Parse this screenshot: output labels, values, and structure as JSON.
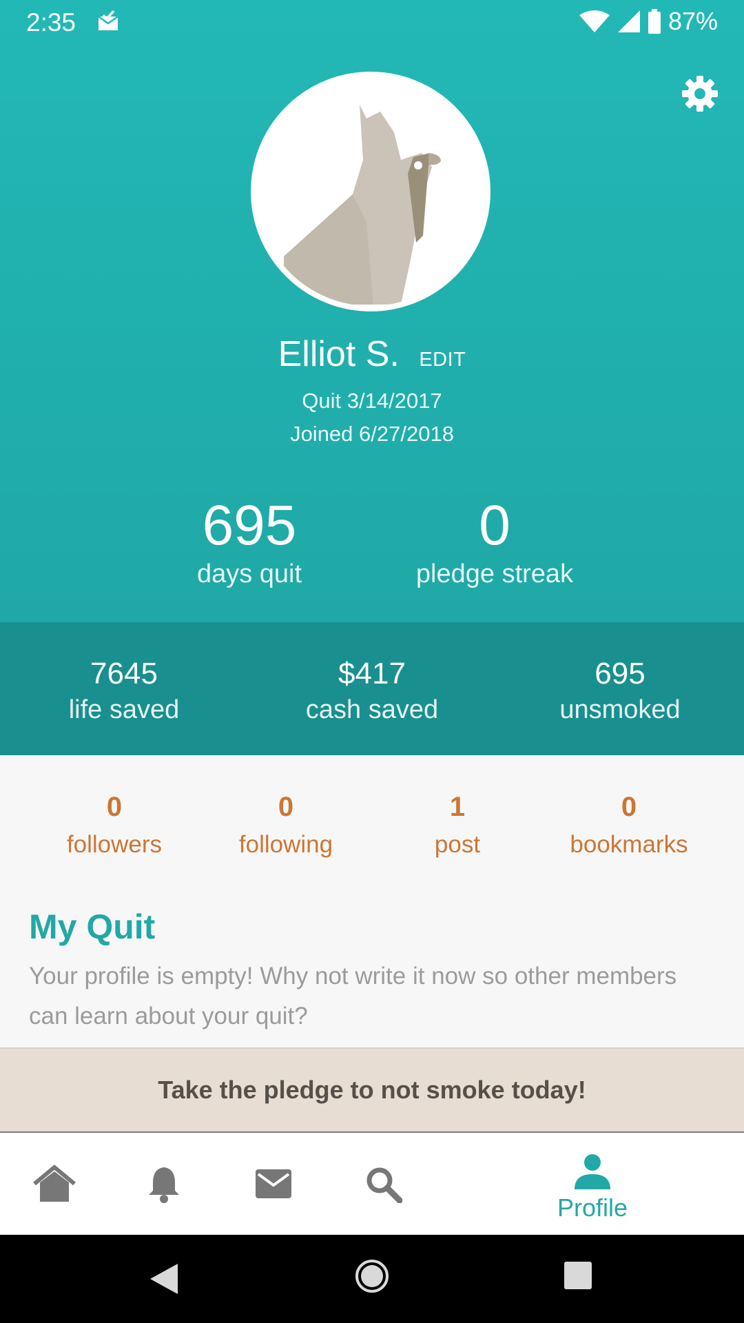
{
  "status_bar": {
    "time": "2:35",
    "battery": "87%",
    "icons": [
      "mail-check-icon",
      "wifi-icon",
      "signal-icon",
      "battery-icon"
    ]
  },
  "profile": {
    "name": "Elliot S.",
    "edit_label": "EDIT",
    "quit_date": "Quit 3/14/2017",
    "joined_date": "Joined 6/27/2018",
    "avatar_icon": "cardinal-bird-avatar"
  },
  "big_stats": [
    {
      "value": "695",
      "label": "days quit"
    },
    {
      "value": "0",
      "label": "pledge streak"
    }
  ],
  "savings": [
    {
      "value": "7645",
      "label": "life saved"
    },
    {
      "value": "$417",
      "label": "cash saved"
    },
    {
      "value": "695",
      "label": "unsmoked"
    }
  ],
  "social": [
    {
      "value": "0",
      "label": "followers"
    },
    {
      "value": "0",
      "label": "following"
    },
    {
      "value": "1",
      "label": "post"
    },
    {
      "value": "0",
      "label": "bookmarks"
    }
  ],
  "my_quit": {
    "title": "My Quit",
    "text": "Your profile is empty! Why not write it now so other members can learn about your quit?"
  },
  "pledge": {
    "label": "Take the pledge to not smoke today!"
  },
  "tabs": [
    {
      "icon": "home-icon"
    },
    {
      "icon": "bell-icon"
    },
    {
      "icon": "mail-icon"
    },
    {
      "icon": "search-icon"
    },
    {
      "icon": "person-icon",
      "label": "Profile",
      "active": true
    }
  ],
  "colors": {
    "teal": "#22b8b6",
    "teal_dark": "#1a8f8f",
    "orange": "#cc7634",
    "pledge_bg": "#e7ddd3"
  }
}
